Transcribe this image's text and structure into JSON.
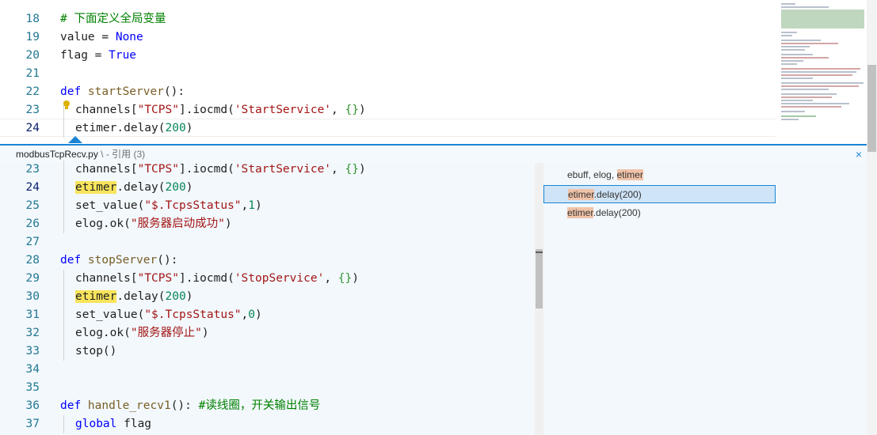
{
  "editor": {
    "lines": [
      {
        "n": "18",
        "parts": [
          {
            "t": "# 下面定义全局变量",
            "c": "cm"
          }
        ]
      },
      {
        "n": "19",
        "parts": [
          {
            "t": "value = "
          },
          {
            "t": "None",
            "c": "kw"
          }
        ]
      },
      {
        "n": "20",
        "parts": [
          {
            "t": "flag = "
          },
          {
            "t": "True",
            "c": "kw"
          }
        ]
      },
      {
        "n": "21",
        "parts": []
      },
      {
        "n": "22",
        "parts": [
          {
            "t": "def ",
            "c": "kw"
          },
          {
            "t": "startServer",
            "c": "fn"
          },
          {
            "t": "():"
          }
        ]
      },
      {
        "n": "23",
        "parts": [
          {
            "t": "channels["
          },
          {
            "t": "\"TCPS\"",
            "c": "str"
          },
          {
            "t": "].iocmd("
          },
          {
            "t": "'StartService'",
            "c": "str"
          },
          {
            "t": ", "
          },
          {
            "t": "{}",
            "c": "br2"
          },
          {
            "t": ")"
          }
        ]
      },
      {
        "n": "24",
        "parts": [
          {
            "t": "etimer.delay("
          },
          {
            "t": "200",
            "c": "num"
          },
          {
            "t": ")"
          }
        ]
      }
    ]
  },
  "peek": {
    "file": "modbusTcpRecv.py",
    "sep": " \\ - ",
    "label": "引用 (3)",
    "close_icon": "×",
    "lines": [
      {
        "n": "23",
        "parts": [
          {
            "t": "channels["
          },
          {
            "t": "\"TCPS\"",
            "c": "str"
          },
          {
            "t": "].iocmd("
          },
          {
            "t": "'StartService'",
            "c": "str"
          },
          {
            "t": ", "
          },
          {
            "t": "{}",
            "c": "br2"
          },
          {
            "t": ")"
          }
        ]
      },
      {
        "n": "24",
        "parts": [
          {
            "t": "etimer",
            "c": "hl"
          },
          {
            "t": ".delay("
          },
          {
            "t": "200",
            "c": "num"
          },
          {
            "t": ")"
          }
        ]
      },
      {
        "n": "25",
        "parts": [
          {
            "t": "set_value("
          },
          {
            "t": "\"$.TcpsStatus\"",
            "c": "str"
          },
          {
            "t": ","
          },
          {
            "t": "1",
            "c": "num"
          },
          {
            "t": ")"
          }
        ]
      },
      {
        "n": "26",
        "parts": [
          {
            "t": "elog.ok("
          },
          {
            "t": "\"服务器启动成功\"",
            "c": "str"
          },
          {
            "t": ")"
          }
        ]
      },
      {
        "n": "27",
        "parts": []
      },
      {
        "n": "28",
        "parts": [
          {
            "t": "def ",
            "c": "kw"
          },
          {
            "t": "stopServer",
            "c": "fn"
          },
          {
            "t": "():"
          }
        ]
      },
      {
        "n": "29",
        "parts": [
          {
            "t": "channels["
          },
          {
            "t": "\"TCPS\"",
            "c": "str"
          },
          {
            "t": "].iocmd("
          },
          {
            "t": "'StopService'",
            "c": "str"
          },
          {
            "t": ", "
          },
          {
            "t": "{}",
            "c": "br2"
          },
          {
            "t": ")"
          }
        ]
      },
      {
        "n": "30",
        "parts": [
          {
            "t": "etimer",
            "c": "hl"
          },
          {
            "t": ".delay("
          },
          {
            "t": "200",
            "c": "num"
          },
          {
            "t": ")"
          }
        ]
      },
      {
        "n": "31",
        "parts": [
          {
            "t": "set_value("
          },
          {
            "t": "\"$.TcpsStatus\"",
            "c": "str"
          },
          {
            "t": ","
          },
          {
            "t": "0",
            "c": "num"
          },
          {
            "t": ")"
          }
        ]
      },
      {
        "n": "32",
        "parts": [
          {
            "t": "elog.ok("
          },
          {
            "t": "\"服务器停止\"",
            "c": "str"
          },
          {
            "t": ")"
          }
        ]
      },
      {
        "n": "33",
        "parts": [
          {
            "t": "stop()"
          }
        ]
      },
      {
        "n": "34",
        "parts": []
      },
      {
        "n": "35",
        "parts": []
      },
      {
        "n": "36",
        "parts": [
          {
            "t": "def ",
            "c": "kw"
          },
          {
            "t": "handle_recv1",
            "c": "fn"
          },
          {
            "t": "(): "
          },
          {
            "t": "#读线圈，开关输出信号",
            "c": "cm"
          }
        ]
      },
      {
        "n": "37",
        "parts": [
          {
            "t": "global ",
            "c": "kw"
          },
          {
            "t": "flag"
          }
        ]
      }
    ],
    "references": [
      {
        "pre": "ebuff, elog, ",
        "hl": "etimer",
        "post": ""
      },
      {
        "pre": "",
        "hl": "etimer",
        "post": ".delay(200)"
      },
      {
        "pre": "",
        "hl": "etimer",
        "post": ".delay(200)"
      }
    ]
  }
}
